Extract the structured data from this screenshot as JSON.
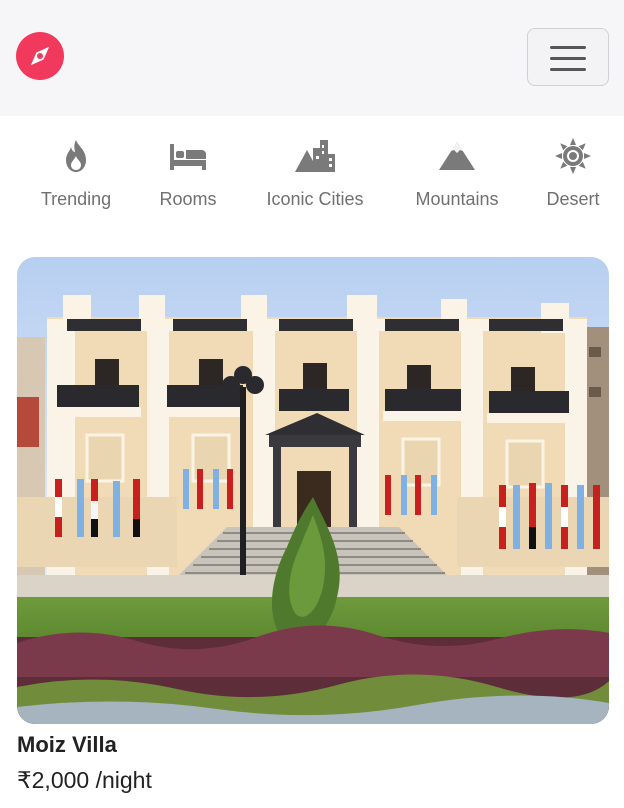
{
  "header": {
    "logo_icon": "compass-icon",
    "brand_color": "#f1395d",
    "menu_icon": "hamburger-menu-icon"
  },
  "categories": [
    {
      "label": "Trending",
      "icon": "fire-icon"
    },
    {
      "label": "Rooms",
      "icon": "bed-icon"
    },
    {
      "label": "Iconic Cities",
      "icon": "city-icon"
    },
    {
      "label": "Mountains",
      "icon": "mountain-icon"
    },
    {
      "label": "Desert",
      "icon": "sun-icon"
    }
  ],
  "listing": {
    "title": "Moiz Villa",
    "currency": "₹",
    "price": "2,000",
    "unit": "/night"
  }
}
